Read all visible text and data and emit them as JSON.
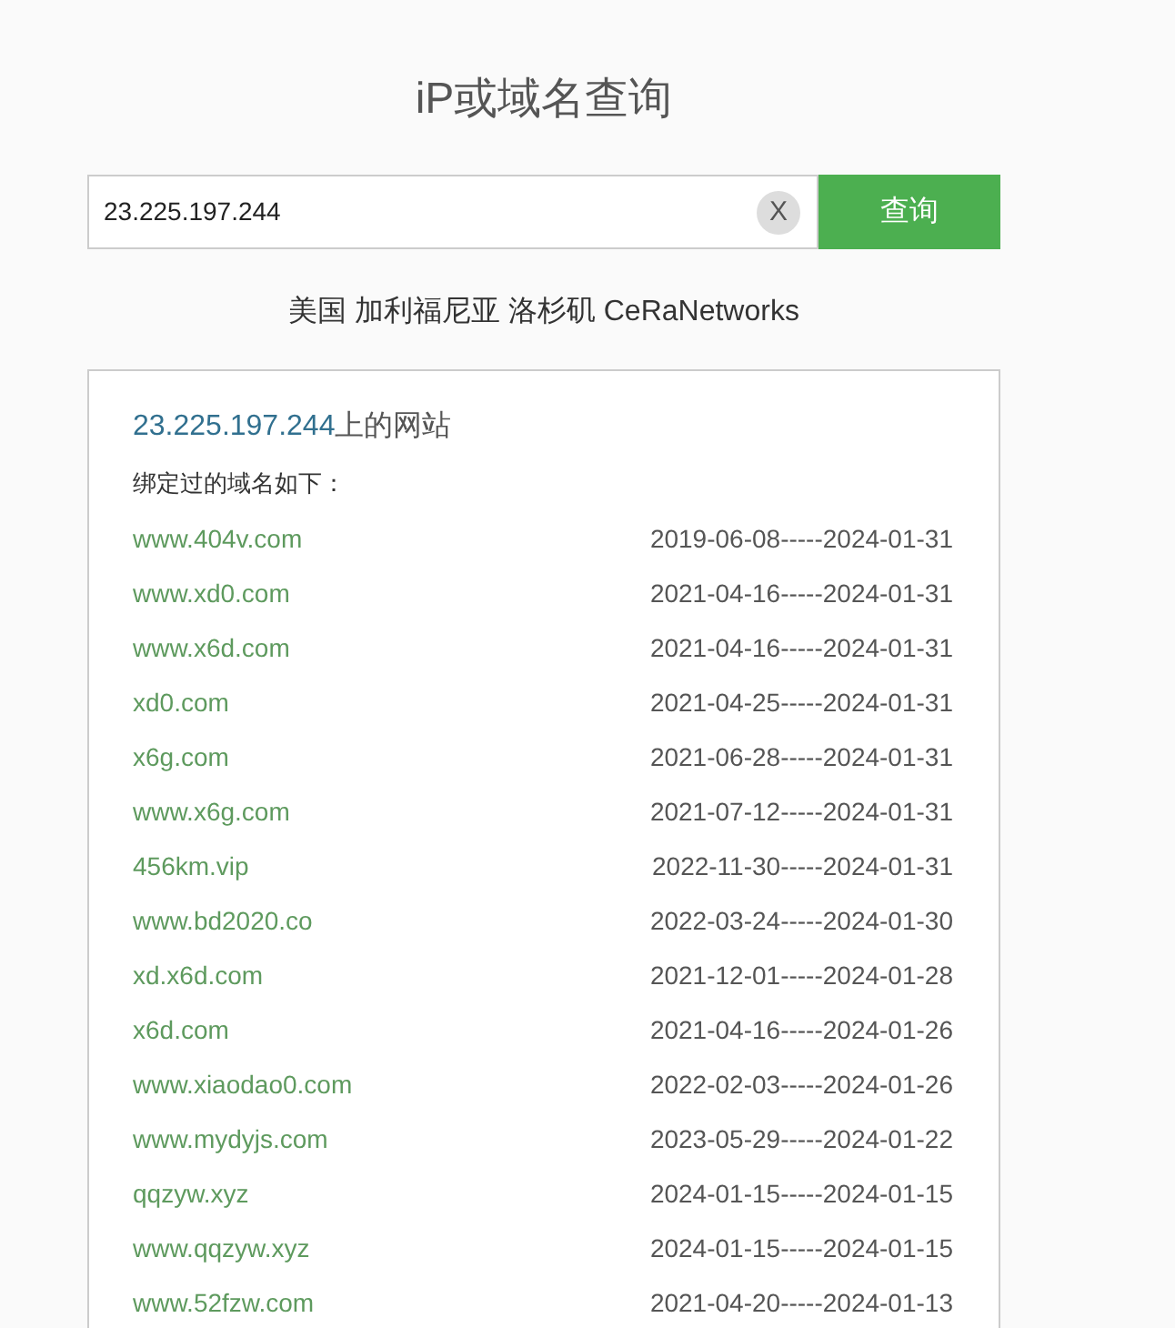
{
  "page": {
    "title": "iP或域名查询"
  },
  "search": {
    "value": "23.225.197.244",
    "clear_label": "X",
    "button_label": "查询"
  },
  "location": "美国 加利福尼亚 洛杉矶 CeRaNetworks",
  "results": {
    "heading_ip": "23.225.197.244",
    "heading_suffix": "上的网站",
    "subtitle": "绑定过的域名如下：",
    "rows": [
      {
        "domain": "www.404v.com",
        "period": "2019-06-08-----2024-01-31"
      },
      {
        "domain": "www.xd0.com",
        "period": "2021-04-16-----2024-01-31"
      },
      {
        "domain": "www.x6d.com",
        "period": "2021-04-16-----2024-01-31"
      },
      {
        "domain": "xd0.com",
        "period": "2021-04-25-----2024-01-31"
      },
      {
        "domain": "x6g.com",
        "period": "2021-06-28-----2024-01-31"
      },
      {
        "domain": "www.x6g.com",
        "period": "2021-07-12-----2024-01-31"
      },
      {
        "domain": "456km.vip",
        "period": "2022-11-30-----2024-01-31"
      },
      {
        "domain": "www.bd2020.co",
        "period": "2022-03-24-----2024-01-30"
      },
      {
        "domain": "xd.x6d.com",
        "period": "2021-12-01-----2024-01-28"
      },
      {
        "domain": "x6d.com",
        "period": "2021-04-16-----2024-01-26"
      },
      {
        "domain": "www.xiaodao0.com",
        "period": "2022-02-03-----2024-01-26"
      },
      {
        "domain": "www.mydyjs.com",
        "period": "2023-05-29-----2024-01-22"
      },
      {
        "domain": "qqzyw.xyz",
        "period": "2024-01-15-----2024-01-15"
      },
      {
        "domain": "www.qqzyw.xyz",
        "period": "2024-01-15-----2024-01-15"
      },
      {
        "domain": "www.52fzw.com",
        "period": "2021-04-20-----2024-01-13"
      }
    ]
  }
}
